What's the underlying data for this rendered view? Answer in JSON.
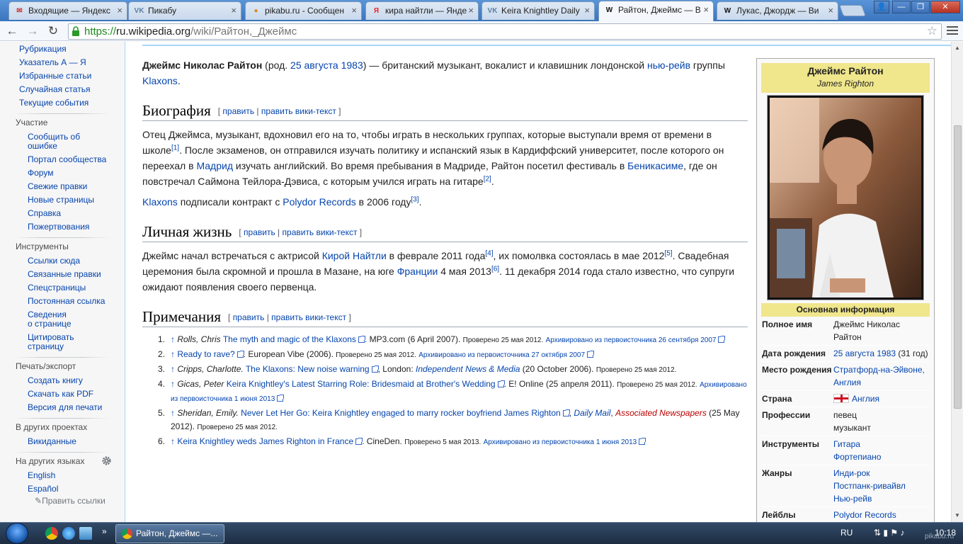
{
  "browser": {
    "tabs": [
      {
        "label": "Входящие — Яндекс",
        "fav": "✉",
        "favColor": "#c33"
      },
      {
        "label": "Пикабу",
        "fav": "VK",
        "favColor": "#5b7fa6"
      },
      {
        "label": "pikabu.ru - Сообщен",
        "fav": "●",
        "favColor": "#d98a1c"
      },
      {
        "label": "кира найтли — Янде",
        "fav": "Я",
        "favColor": "#e22"
      },
      {
        "label": "Keira Knightley Daily",
        "fav": "VK",
        "favColor": "#5b7fa6"
      },
      {
        "label": "Райтон, Джеймс — В",
        "fav": "W",
        "favColor": "#111"
      },
      {
        "label": "Лукас, Джордж — Ви",
        "fav": "W",
        "favColor": "#111"
      }
    ],
    "url": {
      "scheme": "https://",
      "host": "ru.wikipedia.org",
      "path": "/wiki/Райтон,_Джеймс"
    },
    "nav": {
      "back": "←",
      "forward": "→",
      "reload": "↻"
    }
  },
  "sidebar": {
    "top_links": [
      "Рубрикация",
      "Указатель А — Я",
      "Избранные статьи",
      "Случайная статья",
      "Текущие события"
    ],
    "participation": {
      "heading": "Участие",
      "links": [
        "Сообщить об",
        "ошибке",
        "Портал сообщества",
        "Форум",
        "Свежие правки",
        "Новые страницы",
        "Справка",
        "Пожертвования"
      ]
    },
    "tools": {
      "heading": "Инструменты",
      "links": [
        "Ссылки сюда",
        "Связанные правки",
        "Спецстраницы",
        "Постоянная ссылка",
        "Сведения",
        "о странице",
        "Цитировать",
        "страницу"
      ]
    },
    "print": {
      "heading": "Печать/экспорт",
      "links": [
        "Создать книгу",
        "Скачать как PDF",
        "Версия для печати"
      ]
    },
    "projects": {
      "heading": "В других проектах",
      "links": [
        "Викиданные"
      ]
    },
    "languages": {
      "heading": "На других языках",
      "links": [
        "English",
        "Español"
      ],
      "edit": "Править ссылки"
    }
  },
  "article": {
    "lead": {
      "bold": "Джеймс Николас Райтон",
      "t1": " (род. ",
      "date": "25 августа 1983",
      "t2": ") — британский музыкант, вокалист и клавишник лондонской ",
      "genre": "нью-рейв",
      "t3": " группы ",
      "band": "Klaxons",
      "t4": "."
    },
    "edit": "править",
    "edit_src": "править вики-текст",
    "bio": {
      "heading": "Биография",
      "p1a": "Отец Джеймса, музыкант, вдохновил его на то, чтобы играть в нескольких группах, которые выступали время от времени в школе",
      "r1": "[1]",
      "p1b": ". После экзаменов, он отправился изучать политику и испанский язык в Кардиффский университет, после которого он переехал в ",
      "madrid": "Мадрид",
      "p1c": " изучать английский. Во время пребывания в Мадриде, Райтон посетил фестиваль в ",
      "benicasim": "Беникасиме",
      "p1d": ", где он повстречал Саймона Тейлора-Дэвиса, с которым учился играть на гитаре",
      "r2": "[2]",
      "p1e": ".",
      "p2a": "Klaxons",
      "p2b": " подписали контракт с ",
      "p2c": "Polydor Records",
      "p2d": " в 2006 году",
      "r3": "[3]",
      "p2e": "."
    },
    "personal": {
      "heading": "Личная жизнь",
      "a": "Джеймс начал встречаться с актрисой ",
      "keira": "Кирой Найтли",
      "b": " в феврале 2011 года",
      "r4": "[4]",
      "c": ", их помолвка состоялась в мае 2012",
      "r5": "[5]",
      "d": ". Свадебная церемония была скромной и прошла в Мазане, на юге ",
      "france": "Франции",
      "e": " 4 мая 2013",
      "r6": "[6]",
      "f": ". 11 декабря 2014 года стало известно, что супруги ожидают появления своего первенца."
    },
    "notes": {
      "heading": "Примечания",
      "refs": [
        {
          "num": "1.",
          "author": "Rolls, Chris",
          "title": "The myth and magic of the Klaxons",
          "rest": ". MP3.com (6 April 2007).",
          "checked": "Проверено 25 мая 2012.",
          "archive": "Архивировано из первоисточника 26 сентября 2007"
        },
        {
          "num": "2.",
          "author": "",
          "title": "Ready to rave?",
          "rest": ". European Vibe (2006).",
          "checked": "Проверено 25 мая 2012.",
          "archive": "Архивировано из первоисточника 27 октября 2007"
        },
        {
          "num": "3.",
          "author": "Cripps, Charlotte.",
          "title": "The Klaxons: New noise warning",
          "rest": ", London: ",
          "pub": "Independent News & Media",
          "rest2": " (20 October 2006).",
          "checked": "Проверено 25 мая 2012.",
          "archive": ""
        },
        {
          "num": "4.",
          "author": "Gicas, Peter",
          "title": "Keira Knightley's Latest Starring Role: Bridesmaid at Brother's Wedding",
          "rest": ". E! Online (25 апреля 2011).",
          "checked": "Проверено 25 мая 2012.",
          "archive": "Архивировано из первоисточника 1 июня 2013"
        },
        {
          "num": "5.",
          "author": "Sheridan, Emily.",
          "title": "Never Let Her Go: Keira Knightley engaged to marry rocker boyfriend James Righton",
          "rest": ", ",
          "pub": "Daily Mail",
          "pub2": "Associated Newspapers",
          "rest2": " (25 May 2012).",
          "checked": "Проверено 25 мая 2012.",
          "archive": ""
        },
        {
          "num": "6.",
          "author": "",
          "title": "Keira Knightley weds James Righton in France",
          "rest": ". CineDen.",
          "checked": "Проверено 5 мая 2013.",
          "archive": "Архивировано из первоисточника 1 июня 2013"
        }
      ]
    }
  },
  "infobox": {
    "name": "Джеймс Райтон",
    "orig": "James Righton",
    "section": "Основная информация",
    "rows": [
      {
        "label": "Полное имя",
        "val": [
          "Джеймс Николас",
          "Райтон"
        ],
        "link": false
      },
      {
        "label": "Дата рождения",
        "val": [
          "25 августа 1983"
        ],
        "extra": " (31 год)",
        "link": true
      },
      {
        "label": "Место рождения",
        "val": [
          "Стратфорд-на-Эйвоне,",
          "Англия"
        ],
        "link": true
      },
      {
        "label": "Страна",
        "val": [
          "Англия"
        ],
        "link": true,
        "flag": true
      },
      {
        "label": "Профессии",
        "val": [
          "певец",
          "музыкант"
        ],
        "link": false
      },
      {
        "label": "Инструменты",
        "val": [
          "Гитара",
          "Фортепиано"
        ],
        "link": true
      },
      {
        "label": "Жанры",
        "val": [
          "Инди-рок",
          "Постпанк-ривайвл",
          "Нью-рейв"
        ],
        "link": true
      },
      {
        "label": "Лейблы",
        "val": [
          "Polydor Records"
        ],
        "link": true
      }
    ]
  },
  "taskbar": {
    "task": "Райтон, Джеймс —...",
    "lang": "RU",
    "time": "10:18",
    "watermark": "pikabu.ru"
  }
}
